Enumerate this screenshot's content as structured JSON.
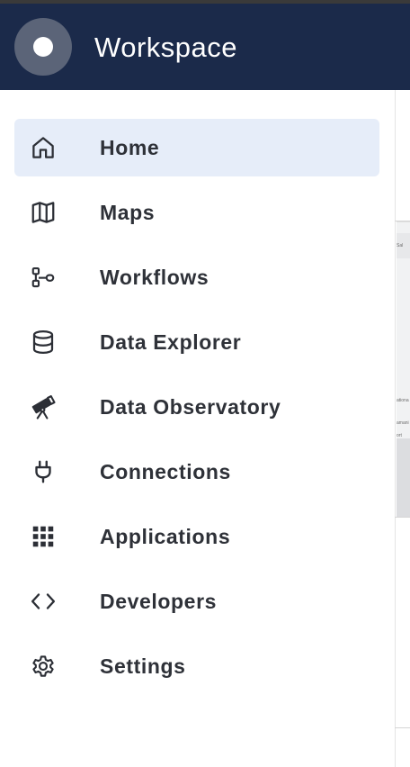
{
  "app": {
    "title": "Workspace"
  },
  "nav": {
    "items": [
      {
        "label": "Home",
        "icon": "home-icon",
        "active": true
      },
      {
        "label": "Maps",
        "icon": "map-icon",
        "active": false
      },
      {
        "label": "Workflows",
        "icon": "workflow-icon",
        "active": false
      },
      {
        "label": "Data Explorer",
        "icon": "database-icon",
        "active": false
      },
      {
        "label": "Data Observatory",
        "icon": "telescope-icon",
        "active": false
      },
      {
        "label": "Connections",
        "icon": "plug-icon",
        "active": false
      },
      {
        "label": "Applications",
        "icon": "apps-grid-icon",
        "active": false
      },
      {
        "label": "Developers",
        "icon": "code-icon",
        "active": false
      },
      {
        "label": "Settings",
        "icon": "gear-icon",
        "active": false
      }
    ]
  },
  "background_map": {
    "fragments": [
      "Sal",
      "ationa",
      "amani",
      "ort"
    ]
  },
  "colors": {
    "header_bg": "#1b2a4a",
    "active_bg": "#e6edf9",
    "text": "#2e3138"
  }
}
